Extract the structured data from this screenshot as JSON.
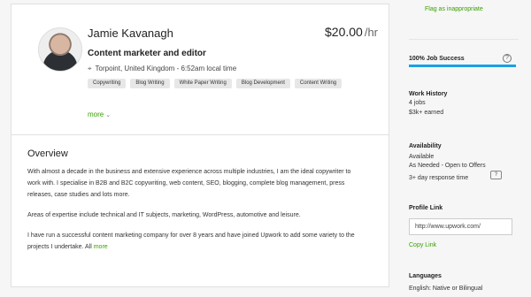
{
  "profile": {
    "name": "Jamie Kavanagh",
    "rate": "$20.00",
    "rate_unit": "/hr",
    "title": "Content marketer and editor",
    "location": "Torpoint, United Kingdom - 6:52am local time",
    "skills": [
      "Copywriting",
      "Blog Writing",
      "White Paper Writing",
      "Blog Development",
      "Content Writing"
    ],
    "more_label": "more",
    "location_icon": "map-pin-icon"
  },
  "overview": {
    "heading": "Overview",
    "paragraph_1": "With almost a decade in the business and extensive experience across multiple industries, I am the ideal copywriter to work with. I specialise in B2B and B2C copywriting, web content, SEO, blogging, complete blog management, press releases, case studies and lots more.",
    "paragraph_2": "Areas of expertise include technical and IT subjects, marketing, WordPress, automotive and leisure.",
    "paragraph_3": "I have run a successful content marketing company for over 8 years and have joined Upwork to add some variety to the projects I undertake. All",
    "more_label": "more"
  },
  "sidebar": {
    "flag_label": "Flag as inappropriate",
    "job_success_label": "100% Job Success",
    "job_success_percent": 100,
    "work_history_label": "Work History",
    "jobs": "4 jobs",
    "earned": "$3k+ earned",
    "availability_label": "Availability",
    "availability_status": "Available",
    "availability_type": "As Needed - Open to Offers",
    "response_time": "3+ day response time",
    "profile_link_label": "Profile Link",
    "profile_link_value": "http://www.upwork.com/",
    "copy_link_label": "Copy Link",
    "languages_label": "Languages",
    "language_value": "English: Native or Bilingual"
  },
  "colors": {
    "accent_green": "#37a000",
    "progress_blue": "#1aa0e8"
  }
}
